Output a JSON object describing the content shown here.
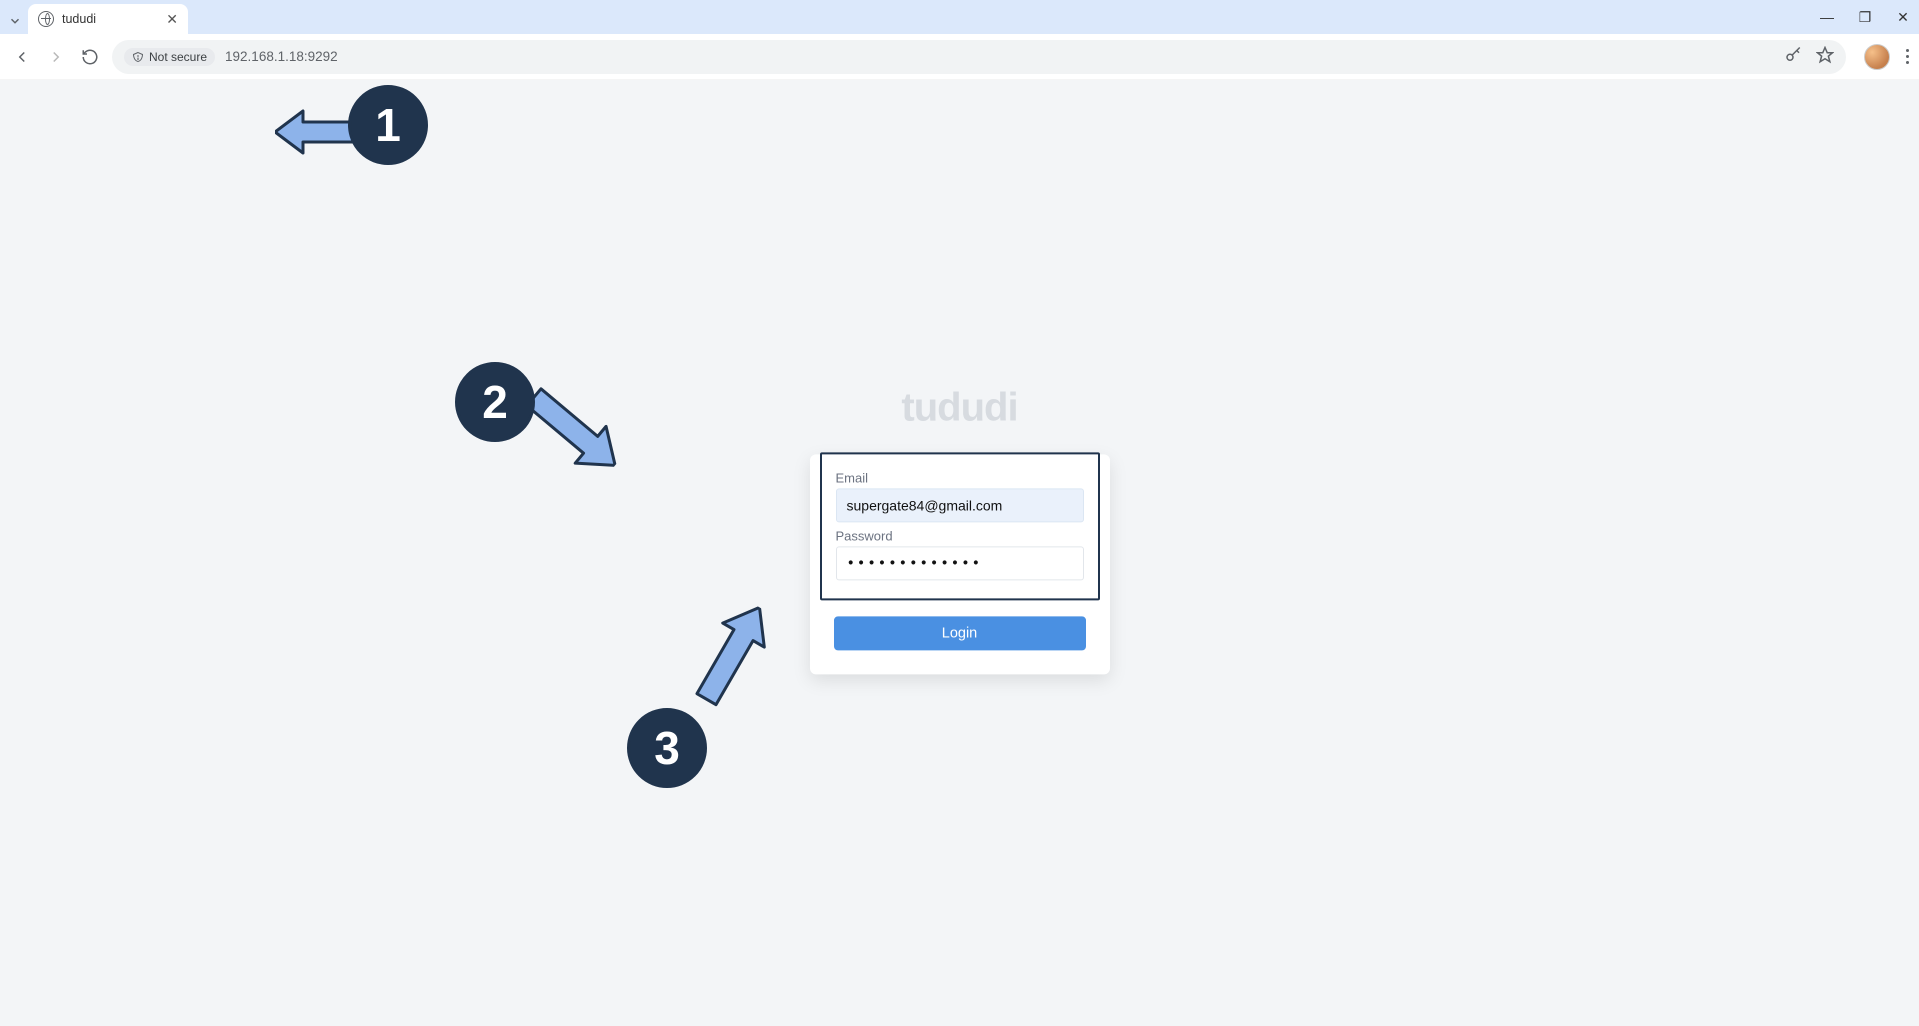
{
  "browser": {
    "tab_title": "tududi",
    "security_label": "Not secure",
    "url": "192.168.1.18:9292"
  },
  "page": {
    "brand": "tududi",
    "email_label": "Email",
    "email_value": "supergate84@gmail.com",
    "password_label": "Password",
    "password_mask": "•••••••••••••",
    "login_label": "Login"
  },
  "annotations": {
    "one": "1",
    "two": "2",
    "three": "3"
  }
}
